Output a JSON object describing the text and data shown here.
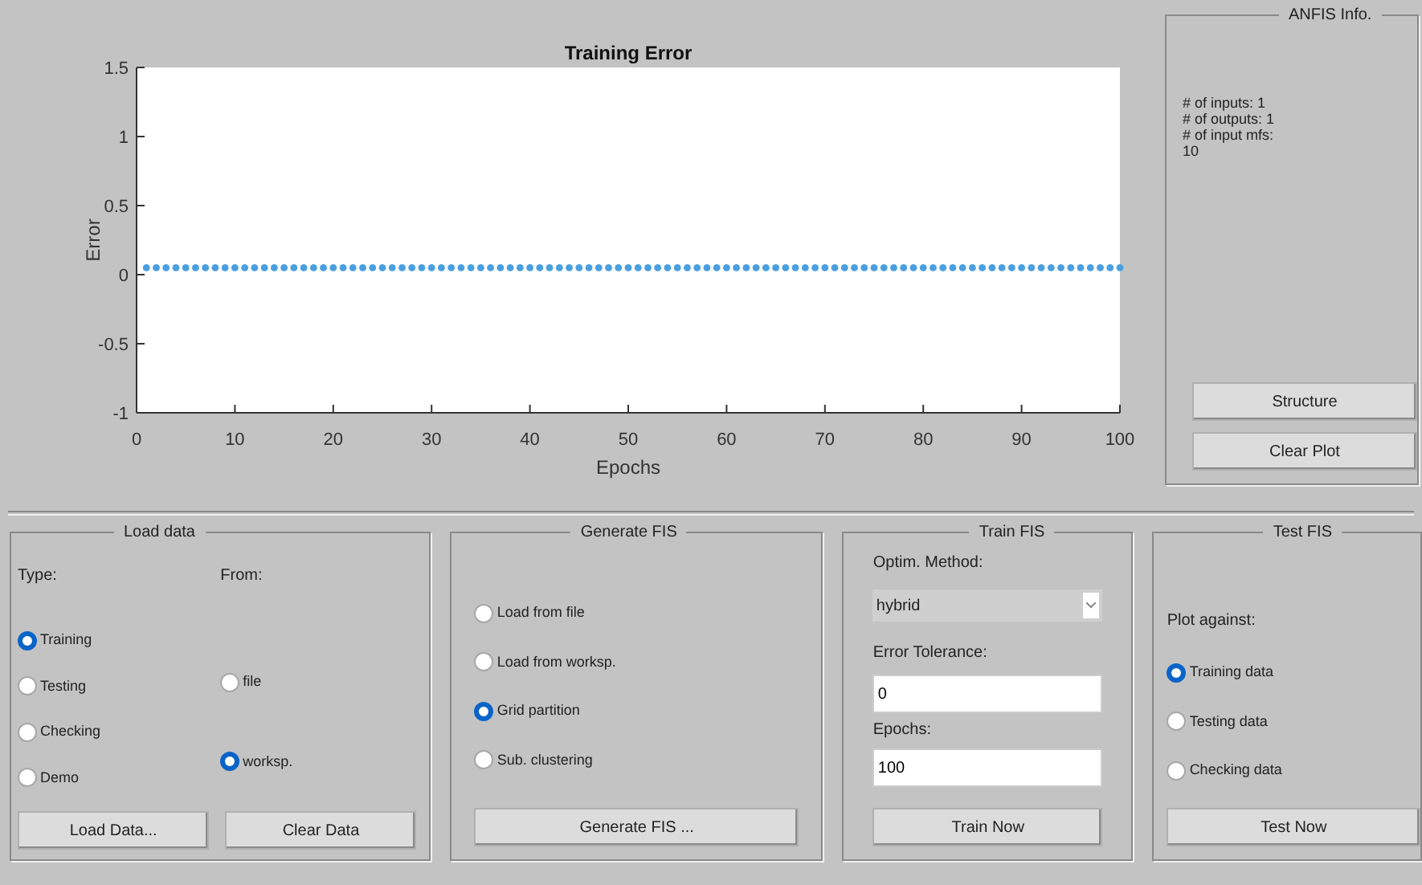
{
  "plot": {
    "chart_data": {
      "type": "scatter",
      "title": "Training Error",
      "xlabel": "Epochs",
      "ylabel": "Error",
      "xlim": [
        0,
        100
      ],
      "ylim": [
        -1,
        1.5
      ],
      "xticks": [
        0,
        10,
        20,
        30,
        40,
        50,
        60,
        70,
        80,
        90,
        100
      ],
      "yticks": [
        {
          "value": -1,
          "label": "-1"
        },
        {
          "value": -0.5,
          "label": "-0.5"
        },
        {
          "value": 0,
          "label": "0"
        },
        {
          "value": 0.5,
          "label": "0.5"
        },
        {
          "value": 1,
          "label": "1"
        },
        {
          "value": 1.5,
          "label": "1.5"
        }
      ],
      "x": [
        1,
        2,
        3,
        4,
        5,
        6,
        7,
        8,
        9,
        10,
        11,
        12,
        13,
        14,
        15,
        16,
        17,
        18,
        19,
        20,
        21,
        22,
        23,
        24,
        25,
        26,
        27,
        28,
        29,
        30,
        31,
        32,
        33,
        34,
        35,
        36,
        37,
        38,
        39,
        40,
        41,
        42,
        43,
        44,
        45,
        46,
        47,
        48,
        49,
        50,
        51,
        52,
        53,
        54,
        55,
        56,
        57,
        58,
        59,
        60,
        61,
        62,
        63,
        64,
        65,
        66,
        67,
        68,
        69,
        70,
        71,
        72,
        73,
        74,
        75,
        76,
        77,
        78,
        79,
        80,
        81,
        82,
        83,
        84,
        85,
        86,
        87,
        88,
        89,
        90,
        91,
        92,
        93,
        94,
        95,
        96,
        97,
        98,
        99,
        100
      ],
      "series": [
        {
          "color": "#4a9fe0",
          "values": [
            0.05,
            0.05,
            0.05,
            0.05,
            0.05,
            0.05,
            0.05,
            0.05,
            0.05,
            0.05,
            0.05,
            0.05,
            0.05,
            0.05,
            0.05,
            0.05,
            0.05,
            0.05,
            0.05,
            0.05,
            0.05,
            0.05,
            0.05,
            0.05,
            0.05,
            0.05,
            0.05,
            0.05,
            0.05,
            0.05,
            0.05,
            0.05,
            0.05,
            0.05,
            0.05,
            0.05,
            0.05,
            0.05,
            0.05,
            0.05,
            0.05,
            0.05,
            0.05,
            0.05,
            0.05,
            0.05,
            0.05,
            0.05,
            0.05,
            0.05,
            0.05,
            0.05,
            0.05,
            0.05,
            0.05,
            0.05,
            0.05,
            0.05,
            0.05,
            0.05,
            0.05,
            0.05,
            0.05,
            0.05,
            0.05,
            0.05,
            0.05,
            0.05,
            0.05,
            0.05,
            0.05,
            0.05,
            0.05,
            0.05,
            0.05,
            0.05,
            0.05,
            0.05,
            0.05,
            0.05,
            0.05,
            0.05,
            0.05,
            0.05,
            0.05,
            0.05,
            0.05,
            0.05,
            0.05,
            0.05,
            0.05,
            0.05,
            0.05,
            0.05,
            0.05,
            0.05,
            0.05,
            0.05,
            0.05,
            0.05
          ]
        }
      ]
    }
  },
  "anfis_info": {
    "title": "ANFIS Info.",
    "lines": [
      "# of inputs: 1",
      "# of outputs: 1",
      "# of input mfs:",
      "10"
    ],
    "buttons": [
      "Structure",
      "Clear Plot"
    ]
  },
  "load_data": {
    "title": "Load data",
    "type_label": "Type:",
    "from_label": "From:",
    "type_options": [
      {
        "label": "Training",
        "selected": true
      },
      {
        "label": "Testing",
        "selected": false
      },
      {
        "label": "Checking",
        "selected": false
      },
      {
        "label": "Demo",
        "selected": false
      }
    ],
    "from_options": [
      {
        "label": "file",
        "selected": false
      },
      {
        "label": "worksp.",
        "selected": true
      }
    ],
    "buttons": [
      "Load Data...",
      "Clear Data"
    ]
  },
  "generate_fis": {
    "title": "Generate FIS",
    "options": [
      {
        "label": "Load from file",
        "selected": false
      },
      {
        "label": "Load from worksp.",
        "selected": false
      },
      {
        "label": "Grid partition",
        "selected": true
      },
      {
        "label": "Sub. clustering",
        "selected": false
      }
    ],
    "button": "Generate FIS ..."
  },
  "train_fis": {
    "title": "Train FIS",
    "method_label": "Optim. Method:",
    "method_value": "hybrid",
    "tolerance_label": "Error Tolerance:",
    "tolerance_value": "0",
    "epochs_label": "Epochs:",
    "epochs_value": "100",
    "button": "Train Now"
  },
  "test_fis": {
    "title": "Test FIS",
    "plot_label": "Plot against:",
    "options": [
      {
        "label": "Training data",
        "selected": true
      },
      {
        "label": "Testing data",
        "selected": false
      },
      {
        "label": "Checking data",
        "selected": false
      }
    ],
    "button": "Test Now"
  }
}
